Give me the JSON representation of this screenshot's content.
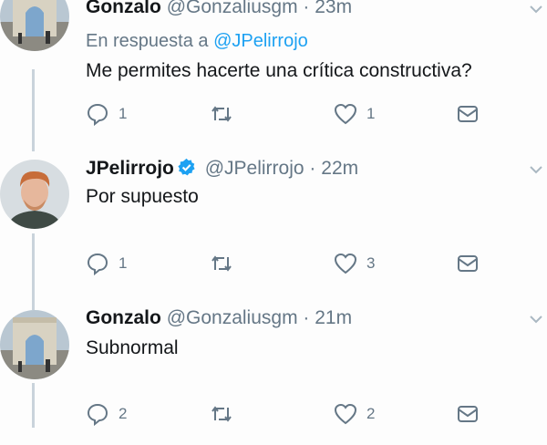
{
  "tweets": [
    {
      "name": "Gonzalo",
      "handle": "@Gonzaliusgm",
      "dot": "·",
      "time": "23m",
      "reply_prefix": "En respuesta a",
      "reply_to": "@JPelirrojo",
      "text": "Me permites hacerte una crítica constructiva?",
      "replies": "1",
      "likes": "1"
    },
    {
      "name": "JPelirrojo",
      "verified": true,
      "handle": "@JPelirrojo",
      "dot": "·",
      "time": "22m",
      "text": "Por supuesto",
      "replies": "1",
      "likes": "3"
    },
    {
      "name": "Gonzalo",
      "handle": "@Gonzaliusgm",
      "dot": "·",
      "time": "21m",
      "text": "Subnormal",
      "replies": "2",
      "likes": "2"
    }
  ],
  "colors": {
    "link": "#1da1f2",
    "muted": "#657786",
    "thread_line": "#c9d3db"
  },
  "icons": [
    "reply-icon",
    "retweet-icon",
    "like-icon",
    "direct-message-icon",
    "verified-badge-icon",
    "chevron-down-icon"
  ]
}
